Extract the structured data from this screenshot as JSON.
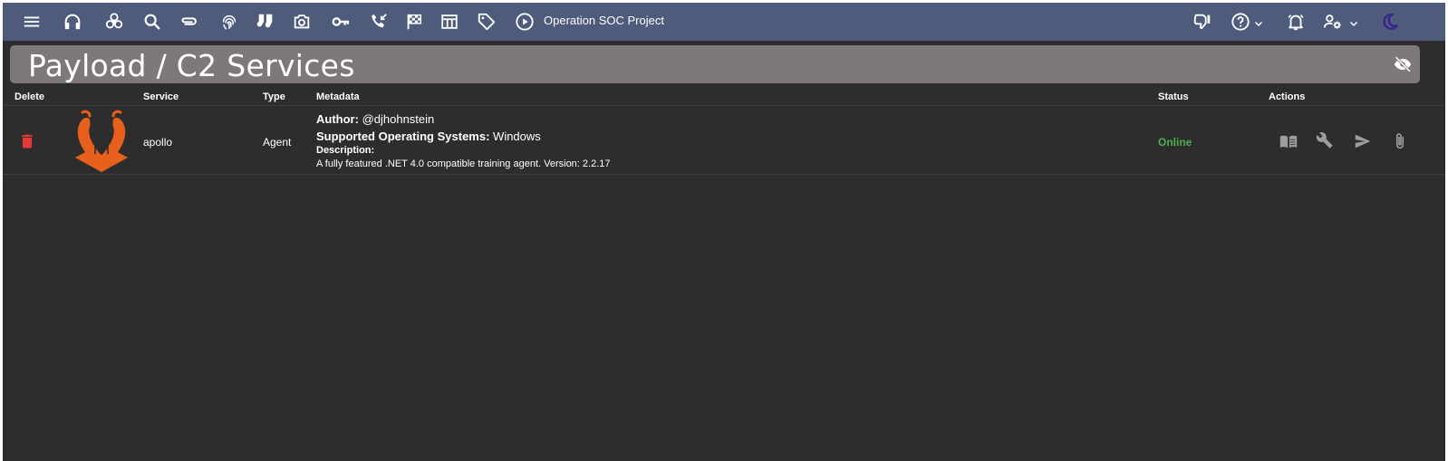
{
  "navbar": {
    "project_name": "Operation SOC Project",
    "icons": [
      "menu-icon",
      "headphones-icon",
      "biohazard-icon",
      "search-icon",
      "paperclip-icon",
      "fingerprint-icon",
      "socks-icon",
      "camera-icon",
      "key-icon",
      "phone-callback-icon",
      "checkered-flag-icon",
      "table-icon",
      "tag-icon",
      "play-circle-icon",
      "thumbs-down-icon",
      "help-icon",
      "alarm-bell-icon",
      "user-settings-icon",
      "dark-mode-moon-icon"
    ]
  },
  "page": {
    "title": "Payload / C2 Services"
  },
  "table": {
    "headers": {
      "delete": "Delete",
      "service": "Service",
      "type": "Type",
      "metadata": "Metadata",
      "status": "Status",
      "actions": "Actions"
    },
    "rows": [
      {
        "service": "apollo",
        "type": "Agent",
        "author_label": "Author:",
        "author": "@djhohnstein",
        "os_label": "Supported Operating Systems:",
        "os": "Windows",
        "description_label": "Description:",
        "description": "A fully featured .NET 4.0 compatible training agent. Version: 2.2.17",
        "status": "Online",
        "status_color": "#4caf50",
        "delete_color": "#e53935",
        "logo_color": "#e8601c"
      }
    ]
  }
}
